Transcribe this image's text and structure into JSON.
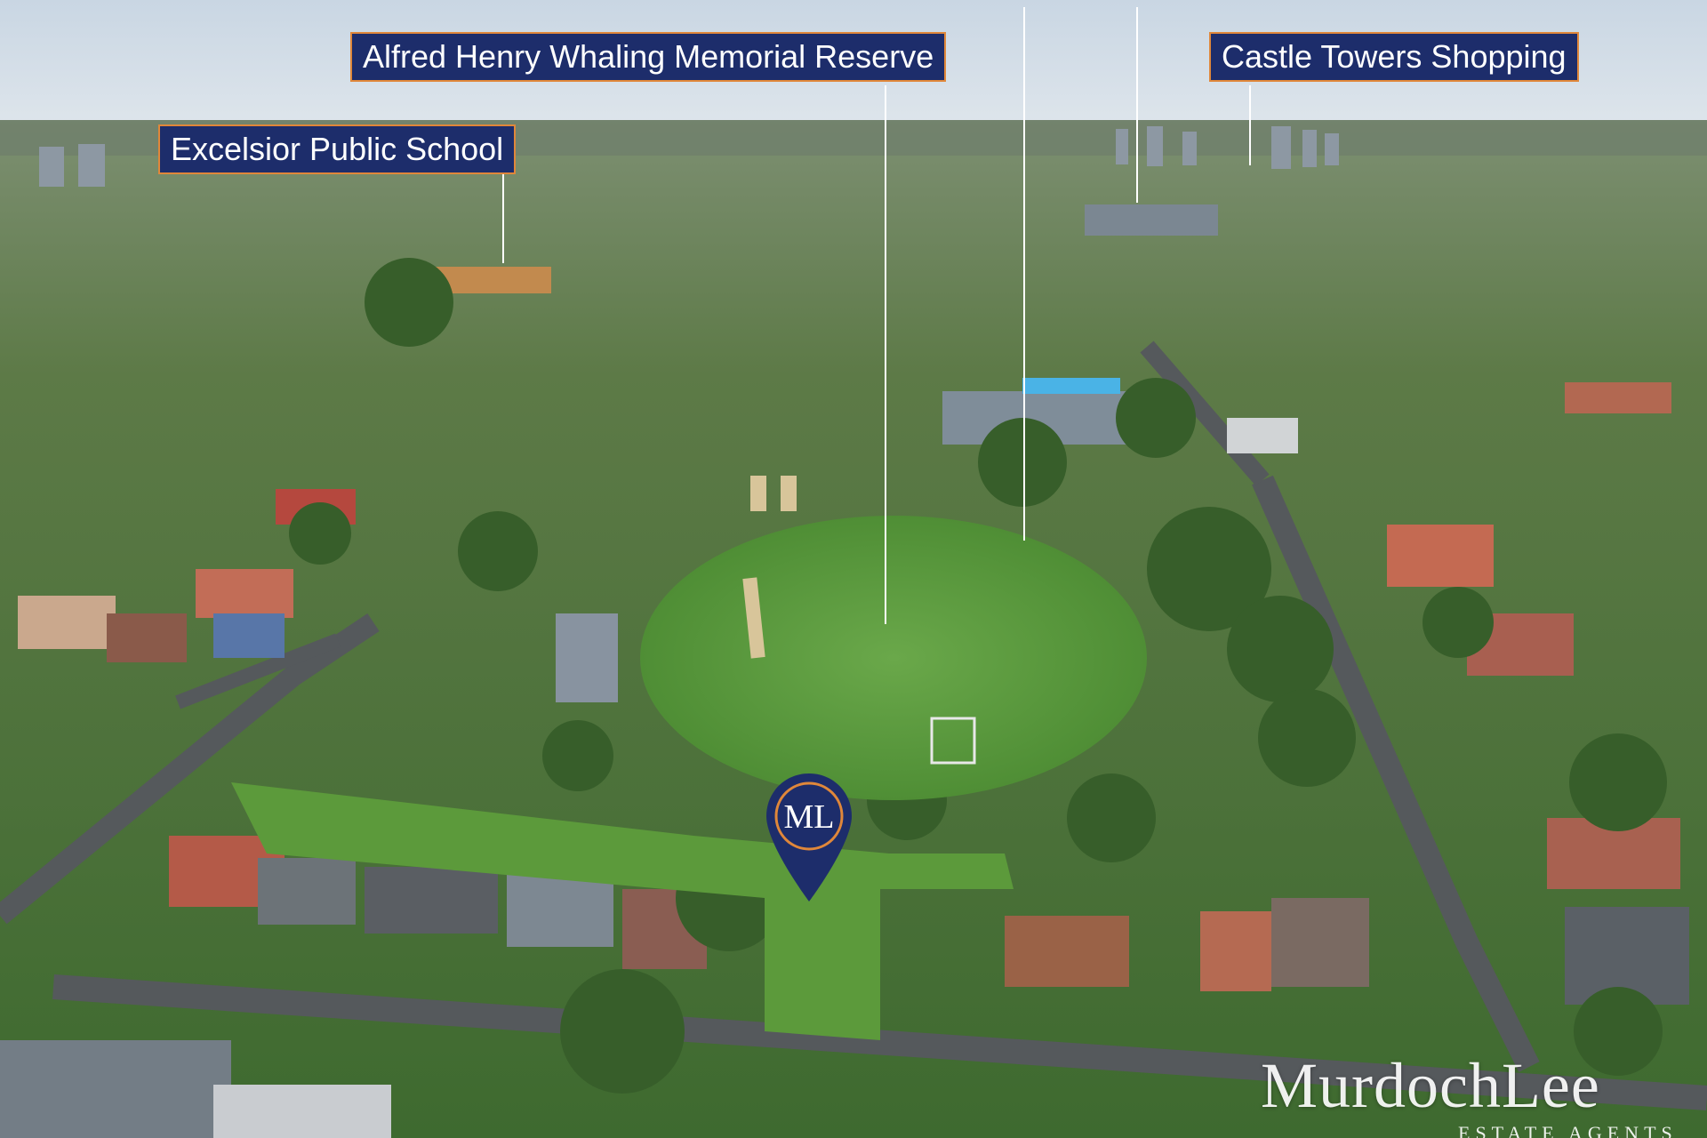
{
  "labels": {
    "top_left_partial": "",
    "top_right_partial": "",
    "alfred": "Alfred Henry Whaling Memorial Reserve",
    "castle": "Castle Towers Shopping",
    "excelsior": "Excelsior Public School"
  },
  "pin": {
    "monogram": "ML",
    "color": "#1d2d6b"
  },
  "watermark": {
    "brand": "MurdochLee",
    "sub": "ESTATE AGENTS"
  },
  "colors": {
    "label_bg": "#1d2d6b",
    "label_border": "#e0873a",
    "field": "#5f9a3e"
  }
}
